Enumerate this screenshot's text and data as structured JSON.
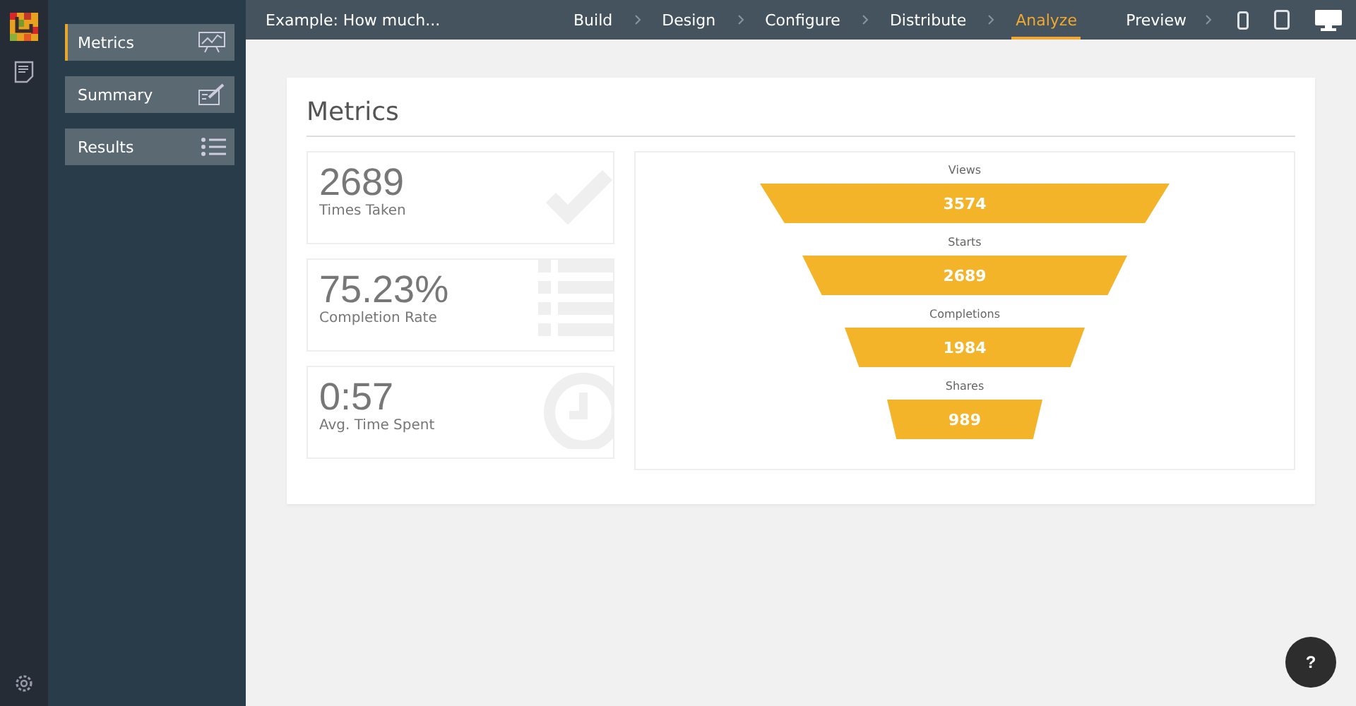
{
  "sidebar": {
    "items": [
      {
        "label": "Metrics",
        "selected": true,
        "kind": "chart"
      },
      {
        "label": "Summary",
        "selected": false,
        "kind": "edit"
      },
      {
        "label": "Results",
        "selected": false,
        "kind": "list"
      }
    ]
  },
  "topbar": {
    "title": "Example: How much...",
    "steps": [
      {
        "label": "Build",
        "selected": false
      },
      {
        "label": "Design",
        "selected": false
      },
      {
        "label": "Configure",
        "selected": false
      },
      {
        "label": "Distribute",
        "selected": false
      },
      {
        "label": "Analyze",
        "selected": true
      }
    ],
    "preview": "Preview",
    "devices": [
      {
        "kind": "phone",
        "selected": false
      },
      {
        "kind": "tablet",
        "selected": false
      },
      {
        "kind": "desktop",
        "selected": true
      }
    ]
  },
  "card": {
    "title": "Metrics",
    "stats": [
      {
        "value": "2689",
        "label": "Times Taken",
        "kind": "check"
      },
      {
        "value": "75.23%",
        "label": "Completion Rate",
        "kind": "list"
      },
      {
        "value": "0:57",
        "label": "Avg. Time Spent",
        "kind": "clock"
      }
    ],
    "funnel": [
      {
        "label": "Views",
        "value": "3574"
      },
      {
        "label": "Starts",
        "value": "2689"
      },
      {
        "label": "Completions",
        "value": "1984"
      },
      {
        "label": "Shares",
        "value": "989"
      }
    ]
  },
  "help": "?"
}
